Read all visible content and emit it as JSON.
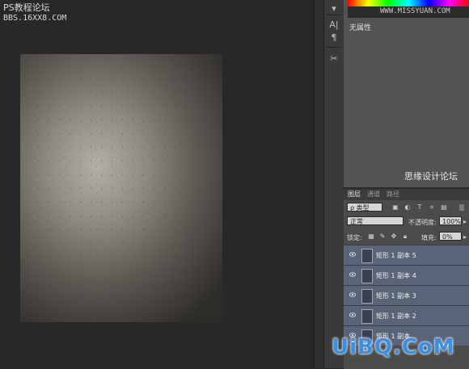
{
  "watermarks": {
    "top_left_line1": "PS教程论坛",
    "top_left_line2": "BBS.16XX8.COM",
    "top_right": "WWW.MISSYUAN.COM",
    "middle_right": "思缘设计论坛",
    "bottom_right": "UiBQ.CoM"
  },
  "toolstrip": {
    "text_tool_glyph": "A|",
    "paragraph_glyph": "¶",
    "tools_glyph": "✂"
  },
  "properties_panel": {
    "label": "无属性"
  },
  "layers_panel": {
    "tabs": [
      "图层",
      "通道",
      "路径"
    ],
    "filter_kind": "ρ 类型",
    "blend_mode": "正常",
    "opacity_label": "不透明度:",
    "opacity_value": "100%",
    "lock_label": "锁定:",
    "fill_label": "填充:",
    "fill_value": "0%",
    "layers": [
      {
        "name": "矩形 1 副本 5"
      },
      {
        "name": "矩形 1 副本 4"
      },
      {
        "name": "矩形 1 副本 3"
      },
      {
        "name": "矩形 1 副本 2"
      },
      {
        "name": "矩形 1 副本"
      }
    ]
  },
  "colors": {
    "workspace_bg": "#282828",
    "panel_bg": "#535353",
    "selected_layer": "#5a6478",
    "watermark_blue": "#3b8fe3"
  }
}
